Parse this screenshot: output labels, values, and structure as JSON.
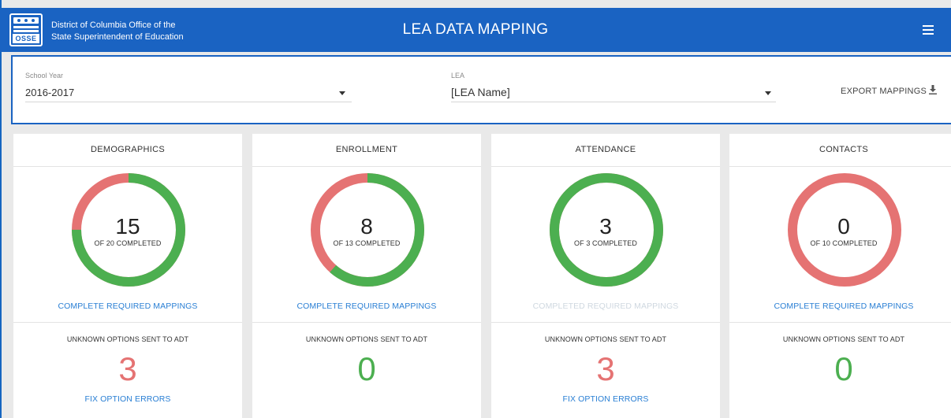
{
  "header": {
    "logo_text": "OSSE",
    "org_line1": "District of Columbia Office of the",
    "org_line2": "State Superintendent of Education",
    "title": "LEA DATA MAPPING"
  },
  "filters": {
    "school_year_label": "School Year",
    "school_year_value": "2016-2017",
    "lea_label": "LEA",
    "lea_value": "[LEA Name]",
    "export_label": "EXPORT MAPPINGS"
  },
  "colors": {
    "complete": "#4caf50",
    "incomplete": "#e57373",
    "brand": "#1a63c2",
    "link": "#2a7fd4"
  },
  "cards": [
    {
      "title": "DEMOGRAPHICS",
      "completed": 15,
      "total": 20,
      "completed_text": "15",
      "of_text": "OF 20 COMPLETED",
      "link": "COMPLETE REQUIRED MAPPINGS",
      "link_enabled": true,
      "unknown_label": "UNKNOWN OPTIONS SENT TO ADT",
      "unknown_count": "3",
      "unknown_status": "error",
      "fix_link": "FIX OPTION ERRORS"
    },
    {
      "title": "ENROLLMENT",
      "completed": 8,
      "total": 13,
      "completed_text": "8",
      "of_text": "OF 13 COMPLETED",
      "link": "COMPLETE REQUIRED MAPPINGS",
      "link_enabled": true,
      "unknown_label": "UNKNOWN OPTIONS SENT TO ADT",
      "unknown_count": "0",
      "unknown_status": "ok",
      "fix_link": ""
    },
    {
      "title": "ATTENDANCE",
      "completed": 3,
      "total": 3,
      "completed_text": "3",
      "of_text": "OF 3 COMPLETED",
      "link": "COMPLETED REQUIRED MAPPINGS",
      "link_enabled": false,
      "unknown_label": "UNKNOWN OPTIONS SENT TO ADT",
      "unknown_count": "3",
      "unknown_status": "error",
      "fix_link": "FIX OPTION ERRORS"
    },
    {
      "title": "CONTACTS",
      "completed": 0,
      "total": 10,
      "completed_text": "0",
      "of_text": "OF 10 COMPLETED",
      "link": "COMPLETE REQUIRED MAPPINGS",
      "link_enabled": true,
      "unknown_label": "UNKNOWN OPTIONS SENT TO ADT",
      "unknown_count": "0",
      "unknown_status": "ok",
      "fix_link": ""
    }
  ]
}
